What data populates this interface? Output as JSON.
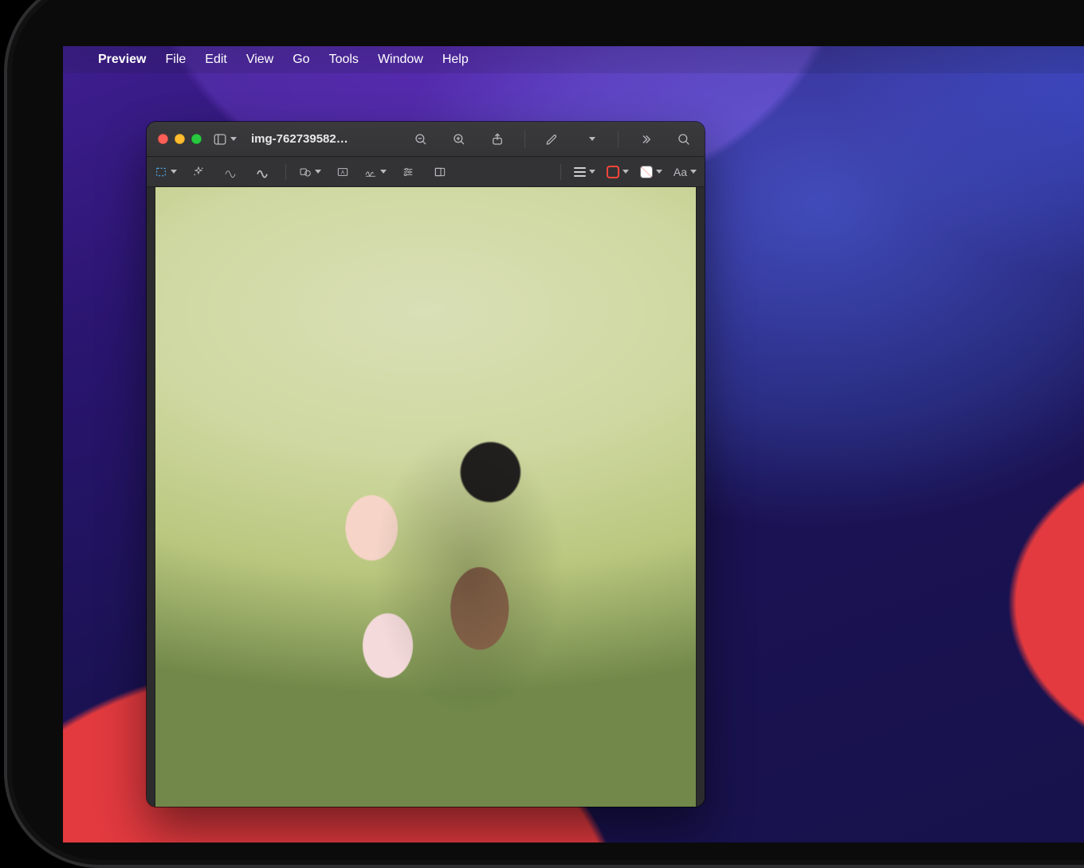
{
  "menubar": {
    "app_name": "Preview",
    "items": [
      "File",
      "Edit",
      "View",
      "Go",
      "Tools",
      "Window",
      "Help"
    ]
  },
  "window": {
    "title": "img-762739582…",
    "titlebar_icons": {
      "sidebar": "sidebar-icon",
      "zoom_out": "zoom-out-icon",
      "zoom_in": "zoom-in-icon",
      "share": "share-icon",
      "markup": "markup-pencil-icon",
      "overflow": "chevrons-right-icon",
      "search": "search-icon"
    }
  },
  "markup_toolbar": {
    "left": [
      {
        "id": "selection",
        "icon": "selection-rect-icon",
        "active": true,
        "dropdown": true
      },
      {
        "id": "instant-alpha",
        "icon": "sparkle-icon"
      },
      {
        "id": "sketch",
        "icon": "squiggle-thin-icon"
      },
      {
        "id": "draw",
        "icon": "squiggle-bold-icon"
      }
    ],
    "mid": [
      {
        "id": "shapes",
        "icon": "shapes-icon",
        "dropdown": true
      },
      {
        "id": "text",
        "icon": "text-box-icon"
      },
      {
        "id": "sign",
        "icon": "signature-icon",
        "dropdown": true
      },
      {
        "id": "adjust-color",
        "icon": "sliders-icon"
      },
      {
        "id": "adjust-size",
        "icon": "resize-icon"
      }
    ],
    "style": [
      {
        "id": "line-style",
        "icon": "hamburger-lines-icon",
        "dropdown": true
      },
      {
        "id": "border-color",
        "icon": "swatch-border",
        "dropdown": true
      },
      {
        "id": "fill-color",
        "icon": "swatch-fill",
        "dropdown": true
      },
      {
        "id": "text-style",
        "label": "Aa",
        "dropdown": true
      }
    ]
  },
  "colors": {
    "accent_red": "#ff453a",
    "accent_blue": "#56b8ff"
  }
}
